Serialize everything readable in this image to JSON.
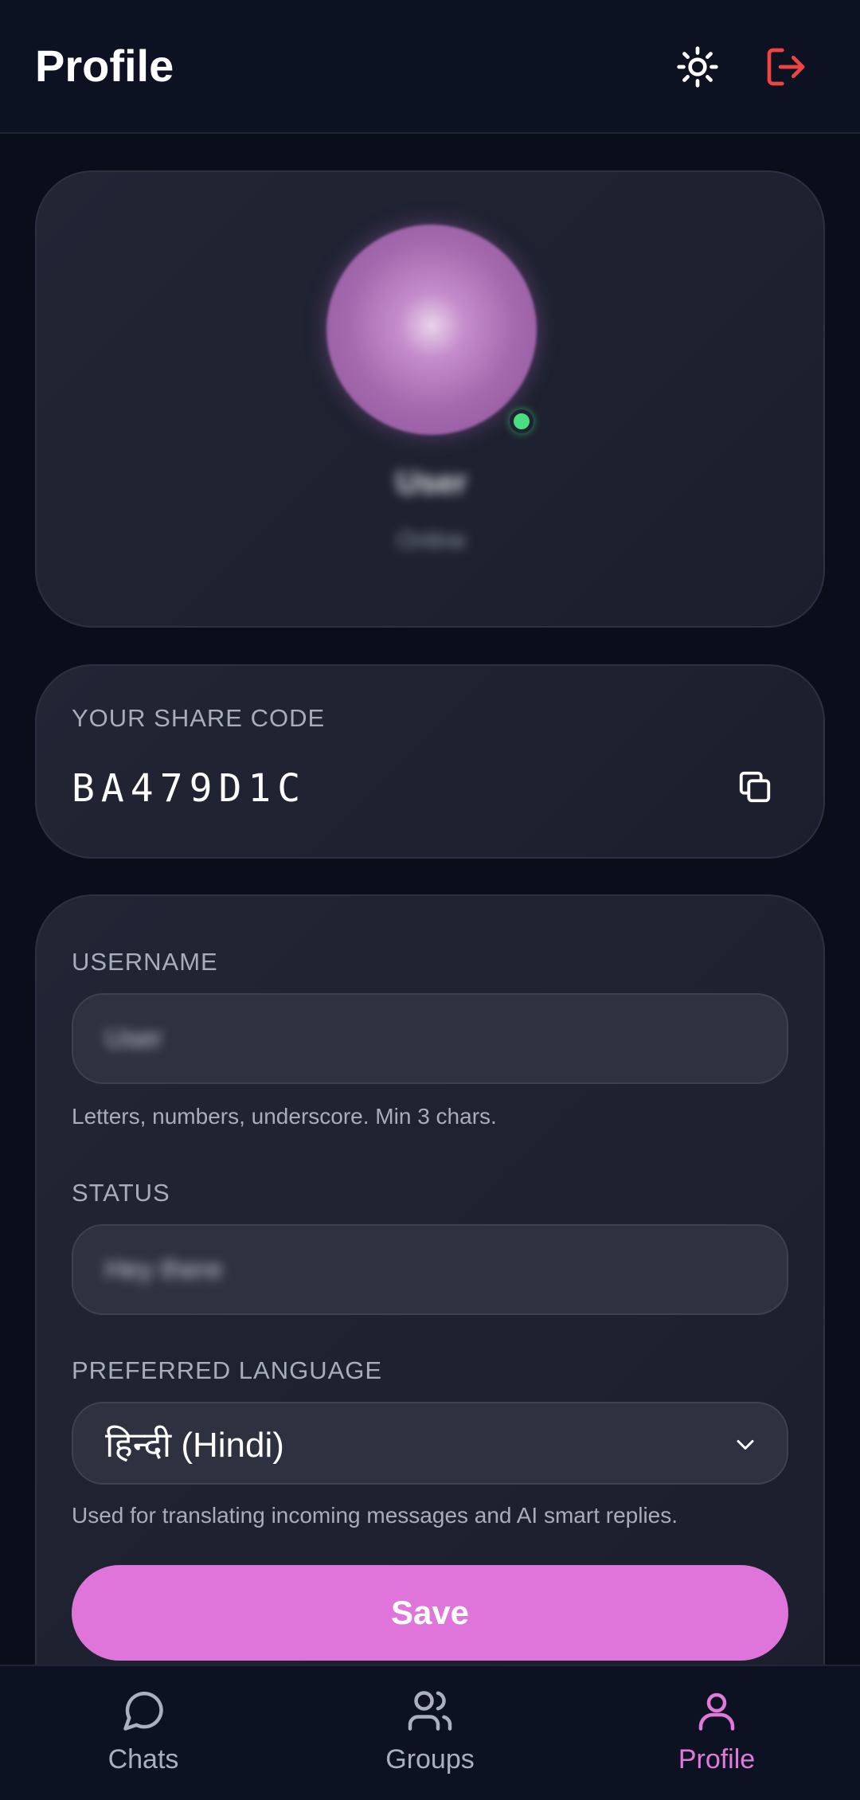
{
  "header": {
    "title": "Profile",
    "theme_icon": "sun-icon",
    "logout_icon": "logout-icon"
  },
  "profile_card": {
    "name": "User",
    "status": "Online",
    "online": true
  },
  "share_code": {
    "label": "YOUR SHARE CODE",
    "code": "BA479D1C",
    "copy_icon": "copy-icon"
  },
  "form": {
    "username_label": "USERNAME",
    "username_value": "User",
    "username_hint": "Letters, numbers, underscore. Min 3 chars.",
    "status_label": "STATUS",
    "status_value": "Hey there",
    "language_label": "PREFERRED LANGUAGE",
    "language_value": "हिन्दी (Hindi)",
    "language_hint": "Used for translating incoming messages and AI smart replies.",
    "save_label": "Save"
  },
  "nav": {
    "items": [
      {
        "label": "Chats",
        "icon": "chat-bubble-icon"
      },
      {
        "label": "Groups",
        "icon": "users-icon"
      },
      {
        "label": "Profile",
        "icon": "user-icon",
        "active": true
      }
    ]
  },
  "colors": {
    "accent": "#df75da",
    "online": "#4ade80",
    "logout": "#ef4444",
    "background": "#0a0e1a"
  }
}
